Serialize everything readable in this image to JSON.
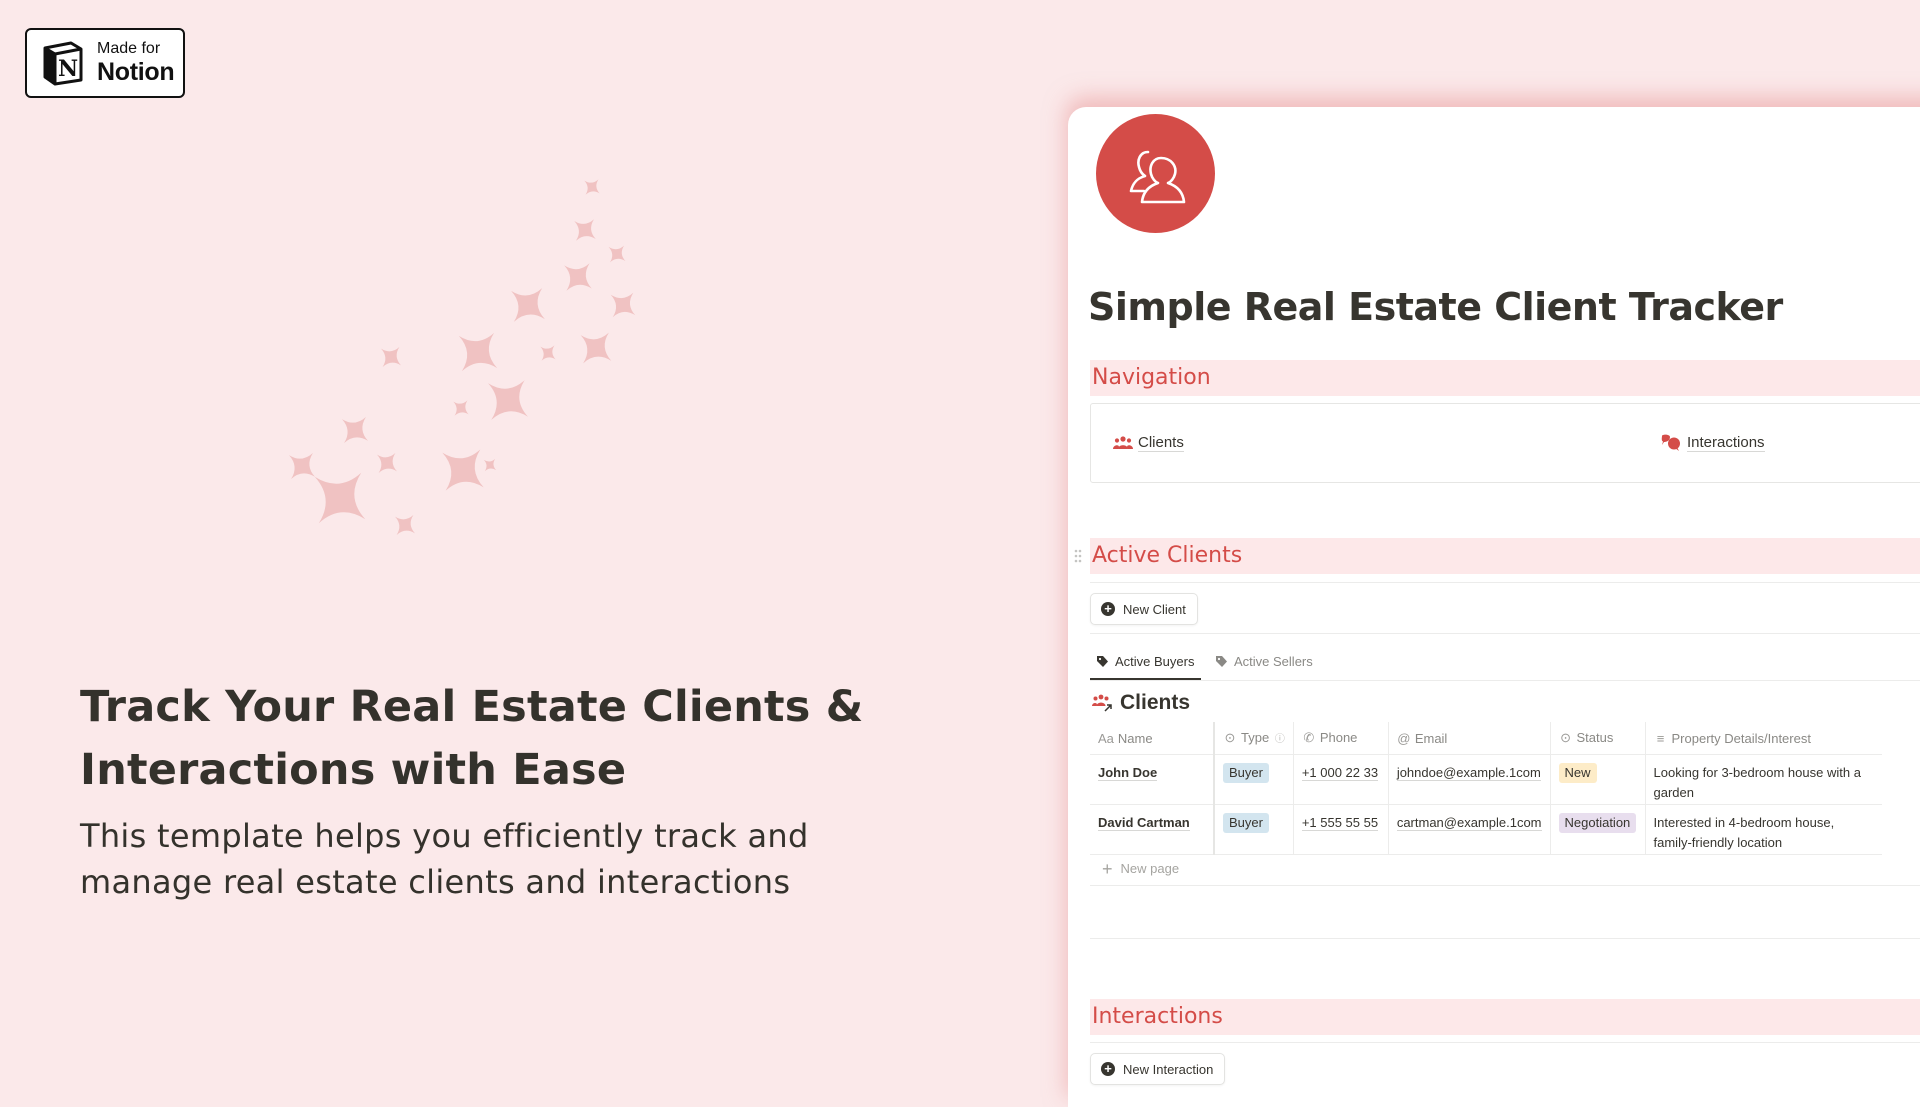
{
  "badge": {
    "line1": "Made for",
    "line2": "Notion",
    "logo_letter": "N"
  },
  "hero": {
    "headline_line1": "Track Your Real Estate Clients &",
    "headline_line2": "Interactions with Ease",
    "sub_line1": "This template helps you efficiently track and",
    "sub_line2": "manage real estate clients and interactions"
  },
  "colors": {
    "background": "#fbe9ea",
    "accent": "#d44c48",
    "heading_band": "#fde8e9",
    "sparkle": "#f0c2c2",
    "text": "#37352f"
  },
  "page": {
    "icon": "users-icon",
    "title": "Simple Real Estate Client Tracker",
    "sections": {
      "navigation": "Navigation",
      "active_clients": "Active Clients",
      "interactions": "Interactions"
    },
    "nav_links": [
      {
        "label": "Clients",
        "icon": "users-icon"
      },
      {
        "label": "Interactions",
        "icon": "chat-bubbles-icon"
      }
    ],
    "new_client_button": "New Client",
    "new_interaction_button": "New Interaction",
    "tabs": [
      {
        "label": "Active Buyers",
        "icon": "tag-icon",
        "active": true
      },
      {
        "label": "Active Sellers",
        "icon": "tag-icon",
        "active": false
      }
    ],
    "database_title": "Clients",
    "columns": [
      {
        "label": "Name",
        "icon": "Aa"
      },
      {
        "label": "Type",
        "icon": "select-icon"
      },
      {
        "label": "Phone",
        "icon": "phone-icon"
      },
      {
        "label": "Email",
        "icon": "@"
      },
      {
        "label": "Status",
        "icon": "select-icon"
      },
      {
        "label": "Property Details/Interest",
        "icon": "text-lines-icon"
      }
    ],
    "rows": [
      {
        "name": "John Doe",
        "type": "Buyer",
        "phone": "+1 000 22 33",
        "email": "johndoe@example.1com",
        "status": "New",
        "details": "Looking for 3-bedroom house with a garden"
      },
      {
        "name": "David Cartman",
        "type": "Buyer",
        "phone": "+1 555 55 55",
        "email": "cartman@example.1com",
        "status": "Negotiation",
        "details": "Interested in 4-bedroom house, family-friendly location"
      }
    ],
    "status_colors": {
      "Buyer": {
        "bg": "#d3e5ef",
        "fg": "#37352f"
      },
      "New": {
        "bg": "#fdecc8",
        "fg": "#37352f"
      },
      "Negotiation": {
        "bg": "#e8deee",
        "fg": "#37352f"
      }
    },
    "new_page_label": "New page"
  }
}
